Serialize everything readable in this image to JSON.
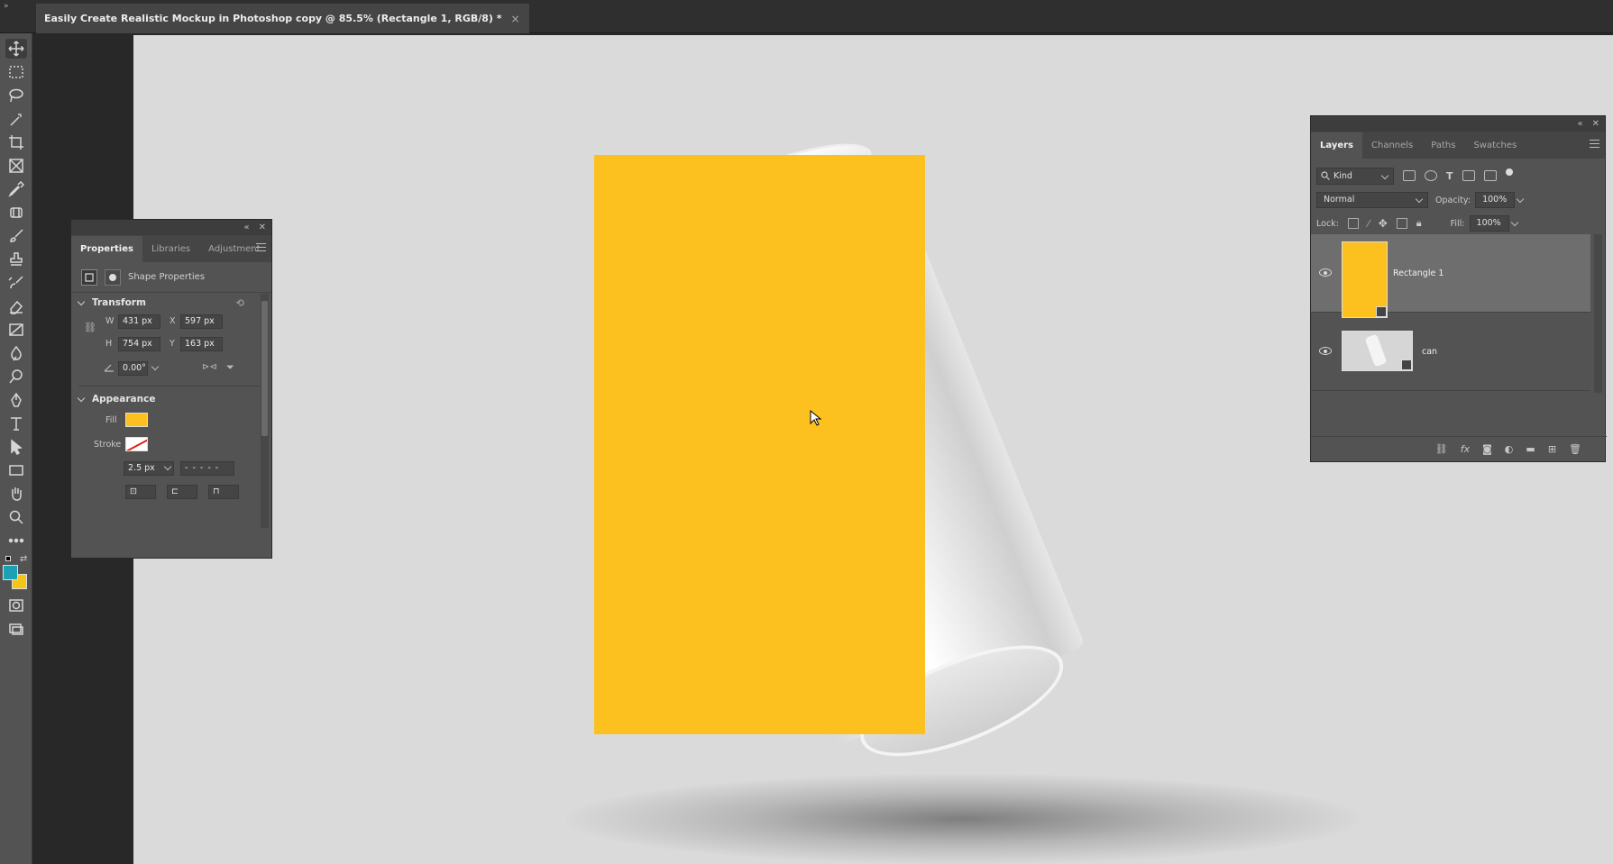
{
  "document_tab": {
    "title": "Easily Create Realistic Mockup in Photoshop copy @ 85.5% (Rectangle 1, RGB/8) *",
    "close": "×"
  },
  "tools": [
    "move",
    "marquee",
    "lasso",
    "magic-wand",
    "crop",
    "frame",
    "eyedropper",
    "patch",
    "brush",
    "stamp",
    "history-brush",
    "eraser",
    "gradient",
    "blur",
    "dodge",
    "pen",
    "type",
    "path-select",
    "rectangle",
    "hand",
    "zoom",
    "more"
  ],
  "colors": {
    "foreground": "#1aa1b3",
    "background": "#f5c518",
    "shape_fill": "#fcc11f"
  },
  "properties": {
    "tabs": [
      "Properties",
      "Libraries",
      "Adjustment"
    ],
    "shape_label": "Shape Properties",
    "transform_label": "Transform",
    "w_label": "W",
    "w_value": "431 px",
    "x_label": "X",
    "x_value": "597 px",
    "h_label": "H",
    "h_value": "754 px",
    "y_label": "Y",
    "y_value": "163 px",
    "angle_value": "0.00°",
    "appearance_label": "Appearance",
    "fill_label": "Fill",
    "stroke_label": "Stroke",
    "stroke_width": "2.5 px"
  },
  "layers_panel": {
    "tabs": [
      "Layers",
      "Channels",
      "Paths",
      "Swatches"
    ],
    "kind": "Kind",
    "blend_mode": "Normal",
    "opacity_label": "Opacity:",
    "opacity_value": "100%",
    "lock_label": "Lock:",
    "fill_label": "Fill:",
    "fill_value": "100%",
    "layers": [
      {
        "name": "Rectangle 1",
        "selected": true
      },
      {
        "name": "can",
        "selected": false
      }
    ],
    "footer_icons": [
      "link",
      "fx",
      "mask",
      "adjustment",
      "folder",
      "new-layer",
      "trash"
    ]
  }
}
